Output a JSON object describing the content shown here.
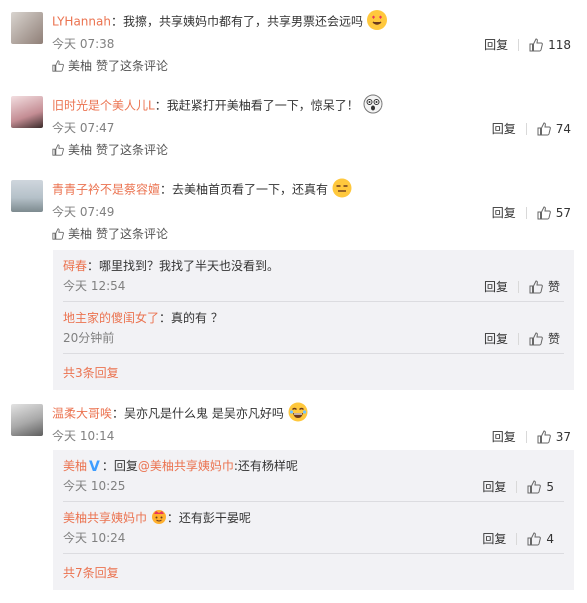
{
  "comments": [
    {
      "user": "LYHannah",
      "text": "：我擦，共享姨妈巾都有了，共享男票还会远吗",
      "time": "今天 07:38",
      "reply": "回复",
      "likes": "118",
      "liked_by_user": "美柚",
      "liked_by_text": "赞了这条评论"
    },
    {
      "user": "旧时光是个美人儿L",
      "text": "：我赶紧打开美柚看了一下，惊呆了！",
      "time": "今天 07:47",
      "reply": "回复",
      "likes": "74",
      "liked_by_user": "美柚",
      "liked_by_text": "赞了这条评论"
    },
    {
      "user": "青青子衿不是蔡容嬗",
      "text": "：去美柚首页看了一下，还真有",
      "time": "今天 07:49",
      "reply": "回复",
      "likes": "57",
      "liked_by_user": "美柚",
      "liked_by_text": "赞了这条评论",
      "replies": [
        {
          "user": "碍春",
          "text": "：哪里找到？我找了半天也没看到。",
          "time": "今天 12:54",
          "reply": "回复",
          "like": "赞"
        },
        {
          "user": "地主家的傻闺女了",
          "text": "：真的有 ？",
          "time": "20分钟前",
          "reply": "回复",
          "like": "赞"
        }
      ],
      "more": "共3条回复"
    },
    {
      "user": "温柔大哥唉",
      "text": "：吴亦凡是什么鬼 是吴亦凡好吗",
      "time": "今天 10:14",
      "reply": "回复",
      "likes": "37",
      "replies": [
        {
          "user": "美柚",
          "reply_prefix": "：回复",
          "mention": "@美柚共享姨妈巾",
          "text": ":还有杨样呢",
          "time": "今天 10:25",
          "reply": "回复",
          "like": "5"
        },
        {
          "user": "美柚共享姨妈巾",
          "text": "：还有彭干晏呢",
          "time": "今天 10:24",
          "reply": "回复",
          "like": "4"
        }
      ],
      "more": "共7条回复"
    }
  ],
  "colors": {
    "username": "#eb7350",
    "sub_bg": "#f2f2f5"
  }
}
